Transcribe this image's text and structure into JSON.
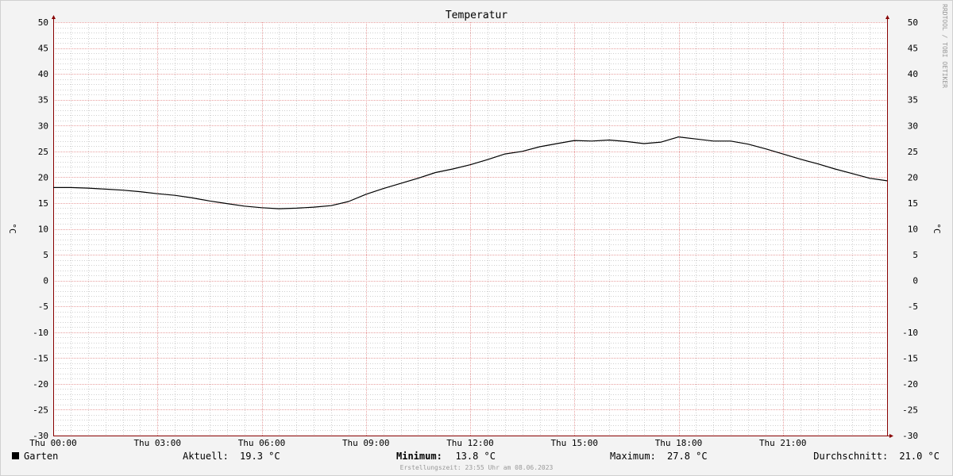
{
  "chart_data": {
    "type": "line",
    "title": "Temperatur",
    "ylabel": "°C",
    "ylabel_right": "°C",
    "ylim": [
      -30,
      50
    ],
    "yticks": [
      50,
      45,
      40,
      35,
      30,
      25,
      20,
      15,
      10,
      5,
      0,
      -5,
      -10,
      -15,
      -20,
      -25,
      -30
    ],
    "xlim": [
      0,
      24
    ],
    "xticks": [
      {
        "x": 0,
        "label": "Thu 00:00"
      },
      {
        "x": 3,
        "label": "Thu 03:00"
      },
      {
        "x": 6,
        "label": "Thu 06:00"
      },
      {
        "x": 9,
        "label": "Thu 09:00"
      },
      {
        "x": 12,
        "label": "Thu 12:00"
      },
      {
        "x": 15,
        "label": "Thu 15:00"
      },
      {
        "x": 18,
        "label": "Thu 18:00"
      },
      {
        "x": 21,
        "label": "Thu 21:00"
      }
    ],
    "grid": true,
    "series": [
      {
        "name": "Garten",
        "color": "#000000",
        "x": [
          0,
          0.5,
          1,
          1.5,
          2,
          2.5,
          3,
          3.5,
          4,
          4.5,
          5,
          5.5,
          6,
          6.5,
          7,
          7.5,
          8,
          8.5,
          9,
          9.5,
          10,
          10.5,
          11,
          11.5,
          12,
          12.5,
          13,
          13.5,
          14,
          14.5,
          15,
          15.5,
          16,
          16.5,
          17,
          17.5,
          18,
          18.5,
          19,
          19.5,
          20,
          20.5,
          21,
          21.5,
          22,
          22.5,
          23,
          23.5,
          24
        ],
        "values": [
          18.0,
          18.0,
          17.9,
          17.7,
          17.5,
          17.2,
          16.8,
          16.5,
          16.0,
          15.4,
          14.9,
          14.4,
          14.1,
          13.9,
          14.0,
          14.2,
          14.5,
          15.3,
          16.7,
          17.8,
          18.8,
          19.8,
          20.9,
          21.6,
          22.4,
          23.4,
          24.5,
          25.0,
          25.9,
          26.5,
          27.1,
          27.0,
          27.2,
          26.9,
          26.5,
          26.8,
          27.8,
          27.4,
          27.0,
          27.0,
          26.4,
          25.5,
          24.5,
          23.5,
          22.6,
          21.6,
          20.7,
          19.8,
          19.3
        ]
      }
    ],
    "legend": {
      "label": "Garten",
      "current_label": "Aktuell:",
      "current_value": "19.3 °C",
      "minimum_label": "Minimum:",
      "minimum_value": "13.8 °C",
      "maximum_label": "Maximum:",
      "maximum_value": "27.8 °C",
      "average_label": "Durchschnitt:",
      "average_value": "21.0 °C"
    },
    "footer": "Erstellungszeit: 23:55 Uhr am 08.06.2023",
    "watermark": "RRDTOOL / TOBI OETIKER"
  },
  "colors": {
    "background": "#f3f3f3",
    "plot_background": "#ffffff",
    "major_grid": "#e8a0a0",
    "minor_grid": "#d0d0d0",
    "axis": "#880000",
    "line": "#000000"
  }
}
